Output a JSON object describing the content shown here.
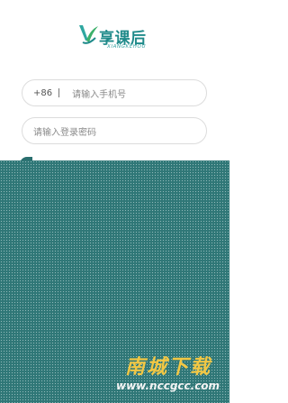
{
  "logo": {
    "title": "享课后",
    "subtitle": "XIANGKEHOU"
  },
  "login": {
    "country_code": "+86",
    "phone_placeholder": "请输入手机号",
    "password_placeholder": "请输入登录密码"
  },
  "watermark": {
    "title": "南城下载",
    "url": "www.nccgcc.com"
  },
  "colors": {
    "brand": "#1f8a8a",
    "overlay": "#2f7777",
    "watermark_gold": "#f2c744"
  }
}
